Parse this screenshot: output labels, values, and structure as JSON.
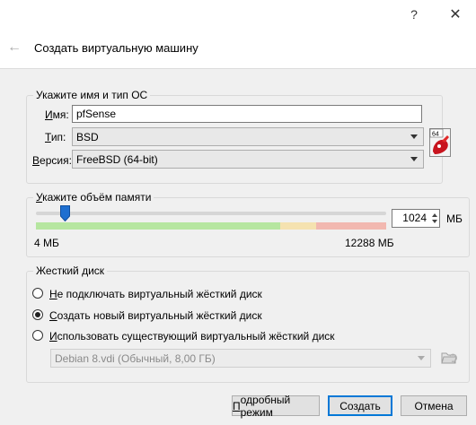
{
  "titlebar": {
    "help_glyph": "?",
    "close_glyph": "✕"
  },
  "header": {
    "title": "Создать виртуальную машину",
    "back_glyph": "←"
  },
  "name_group": {
    "legend": "Укажите имя и тип ОС",
    "name_label_u": "И",
    "name_label_rest": "мя:",
    "name_value": "pfSense",
    "type_label_u": "Т",
    "type_label_rest": "ип:",
    "type_value": "BSD",
    "version_label_u": "В",
    "version_label_rest": "ерсия:",
    "version_value": "FreeBSD (64-bit)",
    "os_icon_badge": "64"
  },
  "memory_group": {
    "legend_u": "У",
    "legend_rest": "кажите объём памяти",
    "value": "1024",
    "unit": "МБ",
    "min_label": "4 МБ",
    "max_label": "12288 МБ",
    "slider_fraction": 0.083
  },
  "disk_group": {
    "legend": "Жесткий диск",
    "option1_u": "Н",
    "option1_rest": "е подключать виртуальный жёсткий диск",
    "option2_u": "С",
    "option2_rest": "оздать новый виртуальный жёсткий диск",
    "option3_u": "И",
    "option3_rest": "спользовать существующий виртуальный жёсткий диск",
    "selected_option": 2,
    "disk_file_value": "Debian 8.vdi (Обычный, 8,00 ГБ)"
  },
  "footer": {
    "expert_label_u": "П",
    "expert_label_rest": "одробный режим",
    "create_label": "Создать",
    "cancel_label": "Отмена"
  },
  "colors": {
    "accent": "#0078d7",
    "scale_green": "#b6e6a0",
    "scale_red": "#f2b8b0",
    "thumb": "#1e6fd0"
  }
}
